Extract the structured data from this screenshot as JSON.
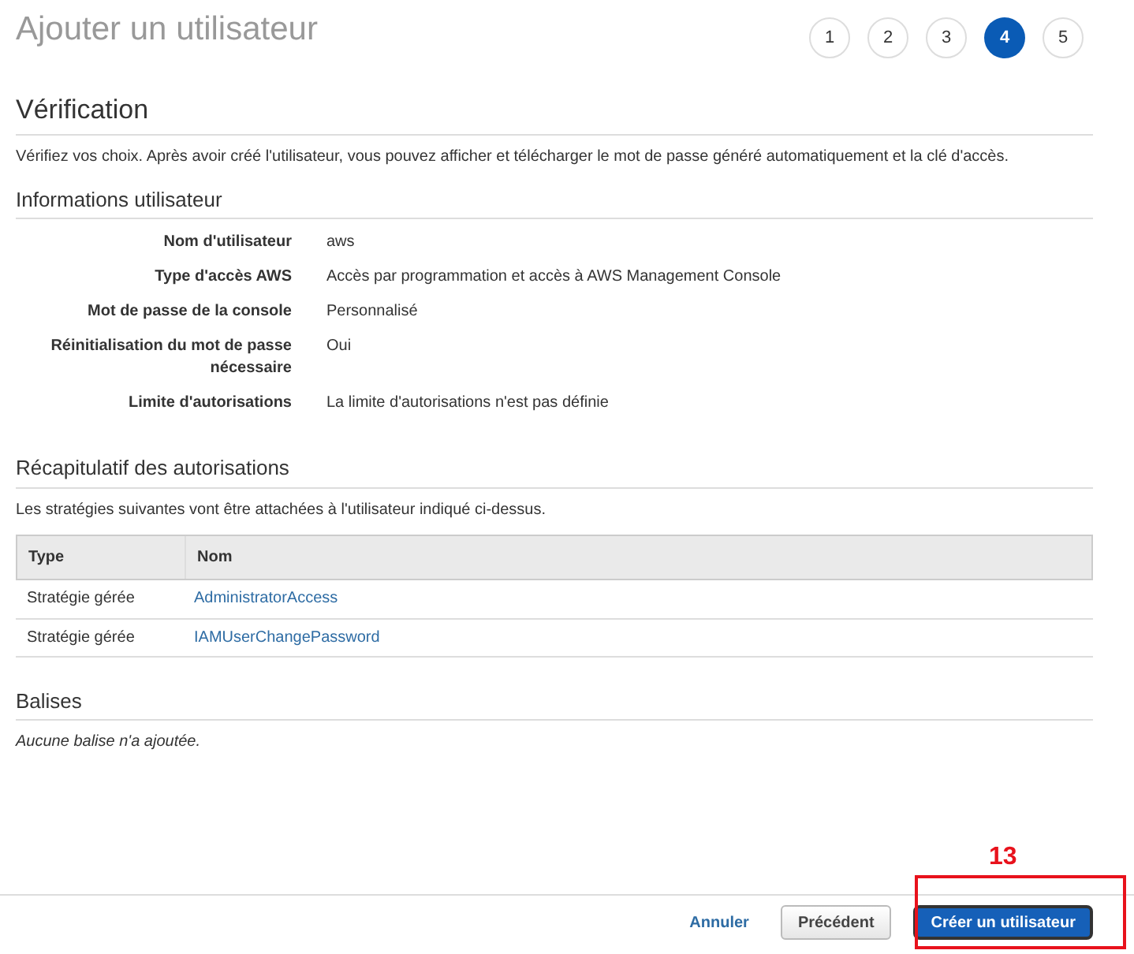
{
  "title": "Ajouter un utilisateur",
  "steps": [
    {
      "label": "1",
      "selected": false
    },
    {
      "label": "2",
      "selected": false
    },
    {
      "label": "3",
      "selected": false
    },
    {
      "label": "4",
      "selected": true
    },
    {
      "label": "5",
      "selected": false
    }
  ],
  "review": {
    "heading": "Vérification",
    "description": "Vérifiez vos choix. Après avoir créé l'utilisateur, vous pouvez afficher et télécharger le mot de passe généré automatiquement et la clé d'accès."
  },
  "user_details": {
    "heading": "Informations utilisateur",
    "rows": [
      {
        "label": "Nom d'utilisateur",
        "value": "aws"
      },
      {
        "label": "Type d'accès AWS",
        "value": "Accès par programmation et accès à AWS Management Console"
      },
      {
        "label": "Mot de passe de la console",
        "value": "Personnalisé"
      },
      {
        "label": "Réinitialisation du mot de passe nécessaire",
        "value": "Oui"
      },
      {
        "label": "Limite d'autorisations",
        "value": "La limite d'autorisations n'est pas définie"
      }
    ]
  },
  "permissions": {
    "heading": "Récapitulatif des autorisations",
    "description": "Les stratégies suivantes vont être attachées à l'utilisateur indiqué ci-dessus.",
    "columns": [
      "Type",
      "Nom"
    ],
    "rows": [
      {
        "type": "Stratégie gérée",
        "name": "AdministratorAccess"
      },
      {
        "type": "Stratégie gérée",
        "name": "IAMUserChangePassword"
      }
    ]
  },
  "tags": {
    "heading": "Balises",
    "empty_text": "Aucune balise n'a ajoutée."
  },
  "footer": {
    "cancel": "Annuler",
    "previous": "Précédent",
    "create": "Créer un utilisateur"
  },
  "annotation": "13"
}
